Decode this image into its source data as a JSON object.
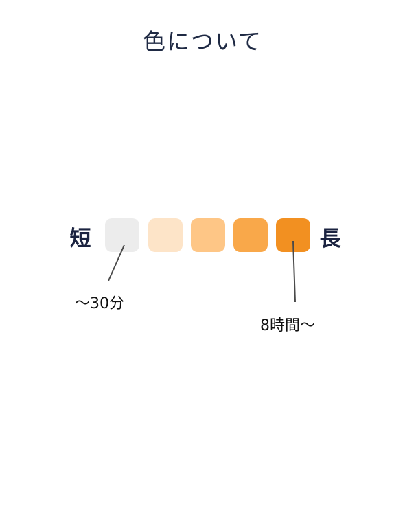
{
  "page": {
    "title": "色について"
  },
  "legend": {
    "short_label": "短",
    "long_label": "長",
    "swatches": [
      {
        "color": "#ececec"
      },
      {
        "color": "#fde4c8"
      },
      {
        "color": "#fec686"
      },
      {
        "color": "#f9a84a"
      },
      {
        "color": "#f29021"
      }
    ],
    "min_callout": "〜30分",
    "max_callout": "8時間〜",
    "line_color": "#4a4a4a"
  }
}
